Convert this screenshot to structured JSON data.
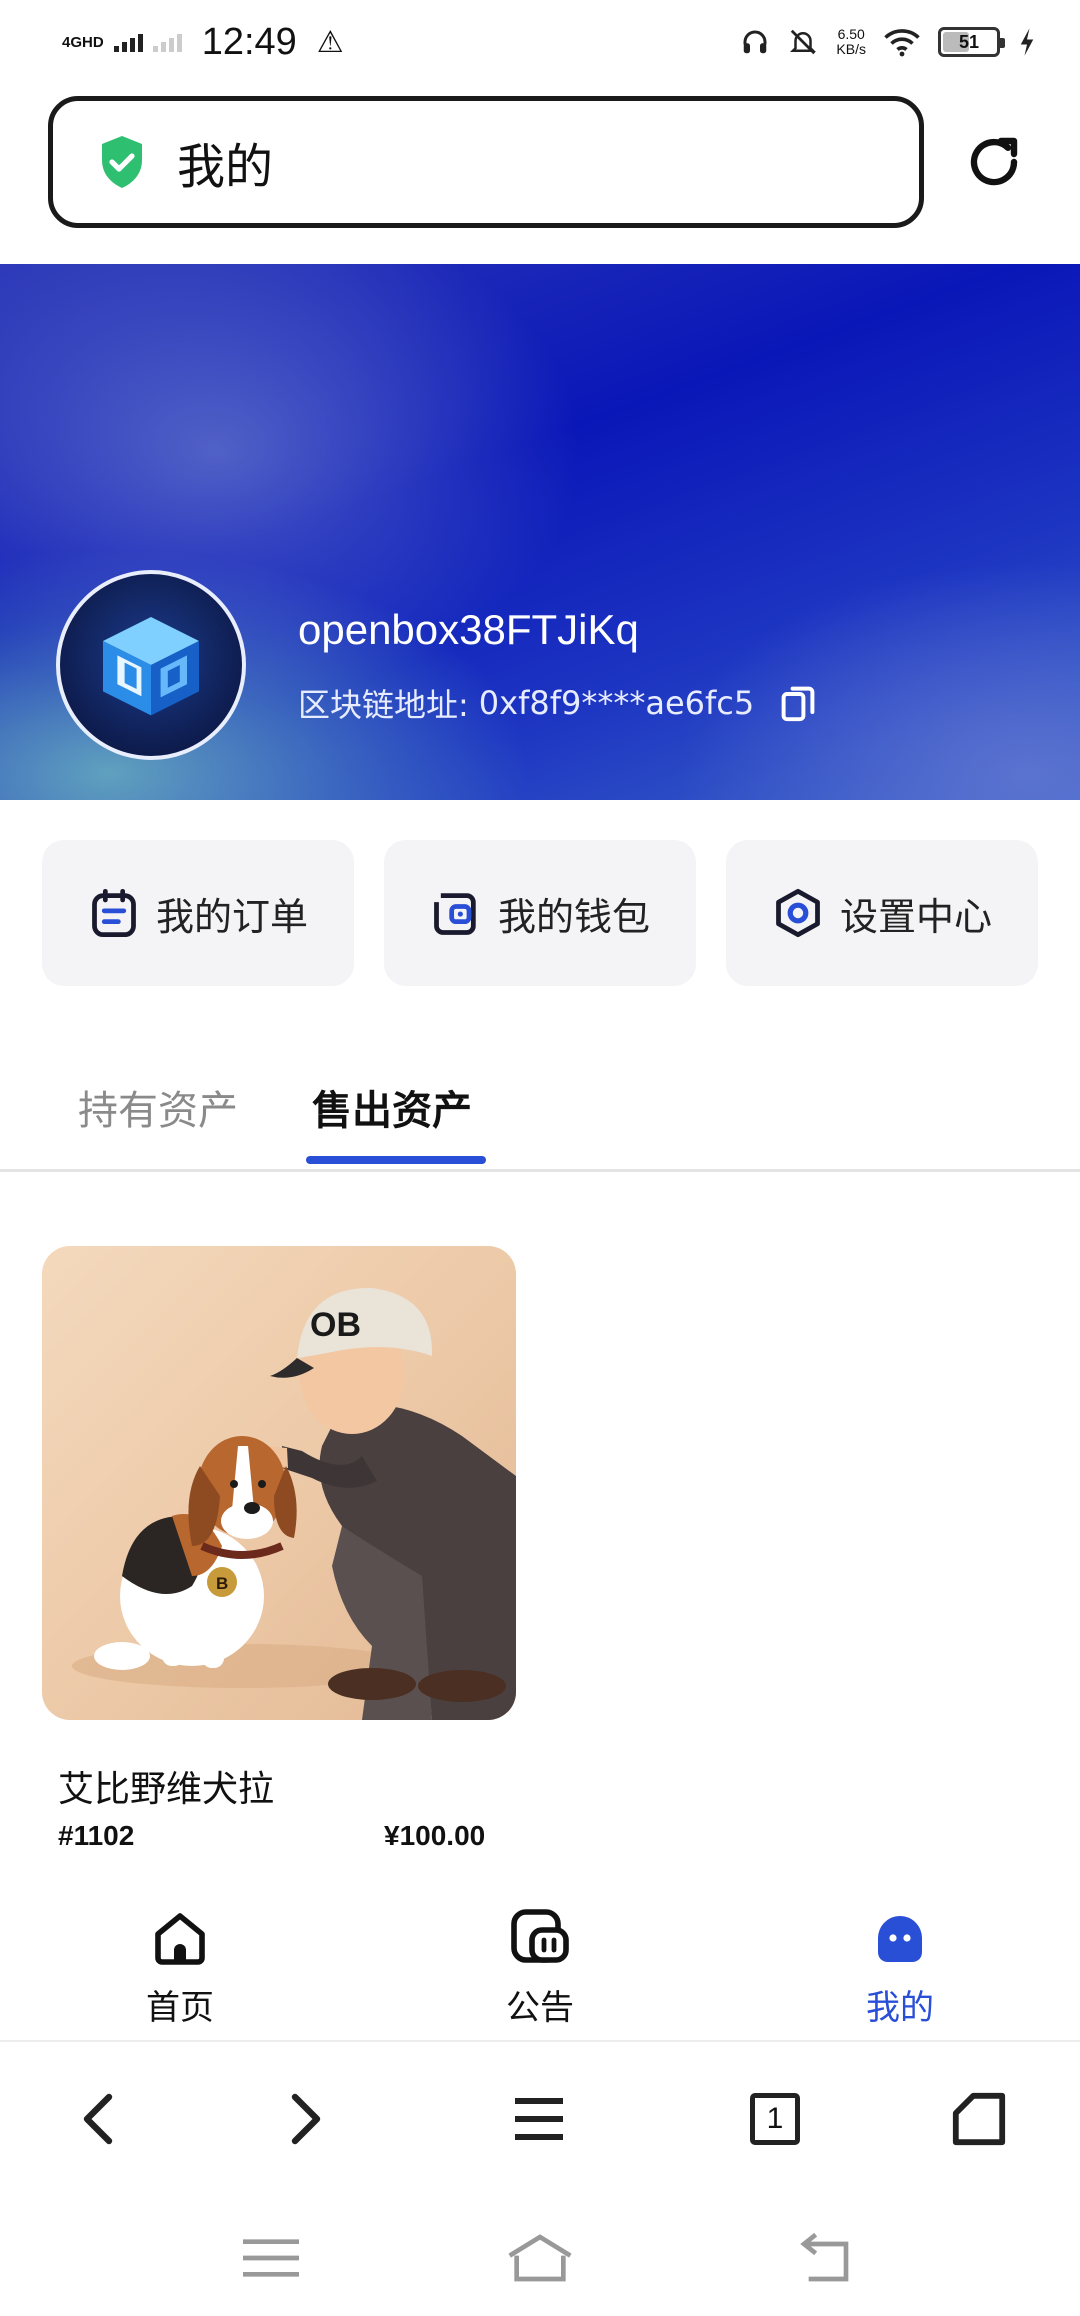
{
  "status_bar": {
    "network_label": "4GHD",
    "time": "12:49",
    "speed_value": "6.50",
    "speed_unit": "KB/s",
    "battery_level": "51",
    "icons": [
      "warning-icon",
      "headphones-icon",
      "mute-icon",
      "wifi-icon",
      "battery-icon",
      "charging-icon"
    ]
  },
  "address_bar": {
    "title": "我的",
    "icons": [
      "shield-check-icon",
      "reload-icon"
    ]
  },
  "profile": {
    "username": "openbox38FTJiKq",
    "address_label": "区块链地址:",
    "address_value": "0xf8f9****ae6fc5"
  },
  "quick_actions": [
    {
      "label": "我的订单",
      "icon": "order-calendar-icon"
    },
    {
      "label": "我的钱包",
      "icon": "wallet-icon"
    },
    {
      "label": "设置中心",
      "icon": "settings-hexagon-icon"
    }
  ],
  "tabs": [
    {
      "label": "持有资产",
      "active": false
    },
    {
      "label": "售出资产",
      "active": true
    }
  ],
  "assets": [
    {
      "name": "艾比野维犬拉",
      "id": "#1102",
      "price": "¥100.00",
      "cap_text": "OB",
      "tag_text": "B"
    }
  ],
  "bottom_nav": [
    {
      "label": "首页",
      "icon": "home-icon",
      "active": false
    },
    {
      "label": "公告",
      "icon": "announcement-icon",
      "active": false
    },
    {
      "label": "我的",
      "icon": "profile-ghost-icon",
      "active": true
    }
  ],
  "browser_toolbar": {
    "tab_count": "1",
    "icons": [
      "back-icon",
      "forward-icon",
      "menu-icon",
      "tabs-icon",
      "browser-home-icon"
    ]
  },
  "system_nav": {
    "icons": [
      "recents-icon",
      "system-home-icon",
      "system-back-icon"
    ]
  },
  "colors": {
    "accent": "#2a4fd7",
    "shield": "#2fbf71",
    "tile_background": "#f4f4f6"
  }
}
